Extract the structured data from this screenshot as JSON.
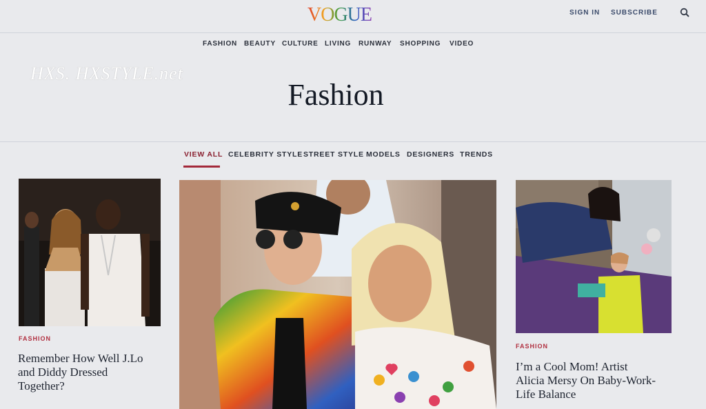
{
  "header": {
    "logo": "VOGUE",
    "sign_in": "SIGN IN",
    "subscribe": "SUBSCRIBE"
  },
  "nav": {
    "items": [
      "FASHION",
      "BEAUTY",
      "CULTURE",
      "LIVING",
      "RUNWAY",
      "SHOPPING",
      "VIDEO"
    ]
  },
  "watermark": "HXS. HXSTYLE.net",
  "page_title": "Fashion",
  "subnav": {
    "items": [
      "VIEW ALL",
      "CELEBRITY STYLE",
      "STREET STYLE",
      "MODELS",
      "DESIGNERS",
      "TRENDS"
    ],
    "active": "VIEW ALL"
  },
  "cards": [
    {
      "kicker": "FASHION",
      "headline_lines": [
        "Remember How Well J.Lo",
        "and Diddy Dressed",
        "Together?"
      ]
    },
    {},
    {
      "kicker": "FASHION",
      "headline_lines": [
        "I’m a Cool Mom! Artist",
        "Alicia Mersy On Baby-Work-",
        "Life Balance"
      ]
    }
  ],
  "colors": {
    "accent": "#a3293a",
    "background": "#e9eaed"
  },
  "icons": {
    "search": "search-icon"
  }
}
